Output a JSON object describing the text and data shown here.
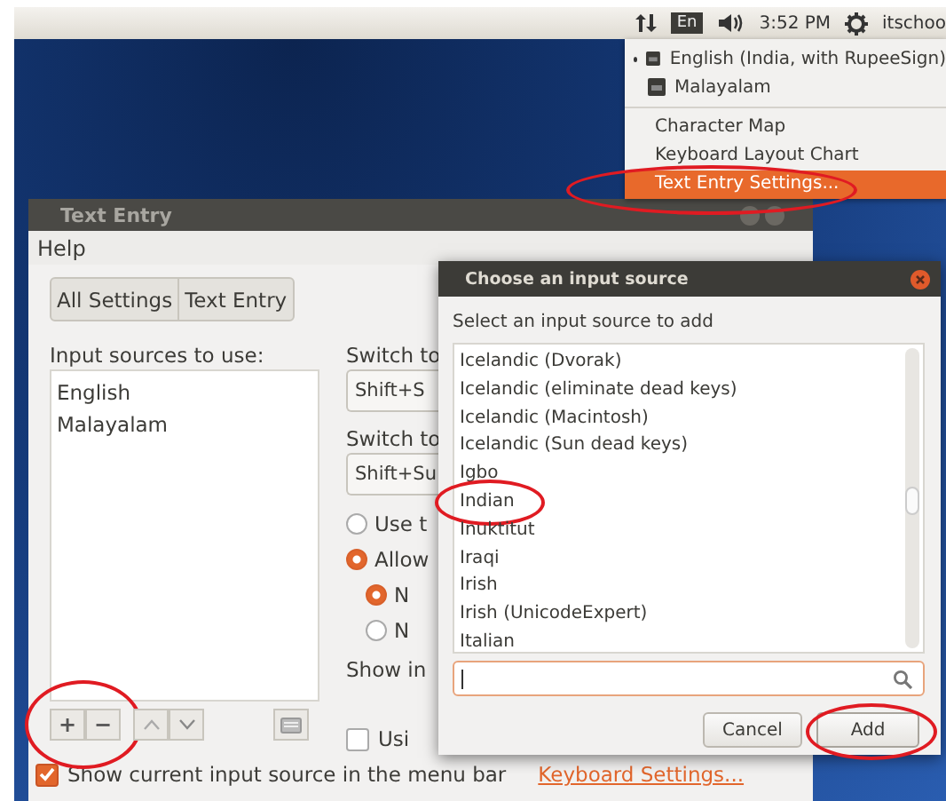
{
  "top_panel": {
    "keyboard_indicator": "En",
    "clock": "3:52 PM",
    "user": "itschoo"
  },
  "indicator_menu": {
    "sources": [
      {
        "label": "English (India, with RupeeSign)",
        "selected": true
      },
      {
        "label": "Malayalam",
        "selected": false
      }
    ],
    "items": [
      {
        "label": "Character Map",
        "highlighted": false,
        "circled": false
      },
      {
        "label": "Keyboard Layout Chart",
        "highlighted": false,
        "circled": false
      },
      {
        "label": "Text Entry Settings...",
        "highlighted": true,
        "circled": true
      }
    ]
  },
  "text_entry_window": {
    "title": "Text Entry",
    "menu": [
      "Help"
    ],
    "breadcrumbs": [
      "All Settings",
      "Text Entry"
    ],
    "sources_label": "Input sources to use:",
    "sources": [
      "English",
      "Malayalam"
    ],
    "toolbar": {
      "add": "+",
      "remove": "−",
      "circled": true
    },
    "switch_next_label": "Switch to",
    "switch_next_value": "Shift+S",
    "switch_prev_label": "Switch to",
    "switch_prev_value": "Shift+Su",
    "radios": [
      {
        "label": "Use t",
        "selected": false
      },
      {
        "label": "Allow",
        "selected": true,
        "children": [
          {
            "label": "N",
            "selected": true
          },
          {
            "label": "N",
            "selected": false
          }
        ]
      }
    ],
    "show_label": "Show in",
    "checkboxes": [
      {
        "label": "Usi",
        "checked": false
      },
      {
        "label": "Show current input source in the menu bar",
        "checked": true
      }
    ],
    "link": "Keyboard Settings..."
  },
  "dialog": {
    "title": "Choose an input source",
    "prompt": "Select an input source to add",
    "items": [
      {
        "label": "Icelandic (Dvorak)",
        "circled": false
      },
      {
        "label": "Icelandic (eliminate dead keys)",
        "circled": false
      },
      {
        "label": "Icelandic (Macintosh)",
        "circled": false
      },
      {
        "label": "Icelandic (Sun dead keys)",
        "circled": false
      },
      {
        "label": "Igbo",
        "circled": false
      },
      {
        "label": "Indian",
        "circled": true
      },
      {
        "label": "Inuktitut",
        "circled": false
      },
      {
        "label": "Iraqi",
        "circled": false
      },
      {
        "label": "Irish",
        "circled": false
      },
      {
        "label": "Irish (UnicodeExpert)",
        "circled": false
      },
      {
        "label": "Italian",
        "circled": false
      }
    ],
    "buttons": [
      {
        "label": "Cancel",
        "kind": "normal",
        "circled": false
      },
      {
        "label": "Add",
        "kind": "default",
        "circled": true
      }
    ]
  }
}
